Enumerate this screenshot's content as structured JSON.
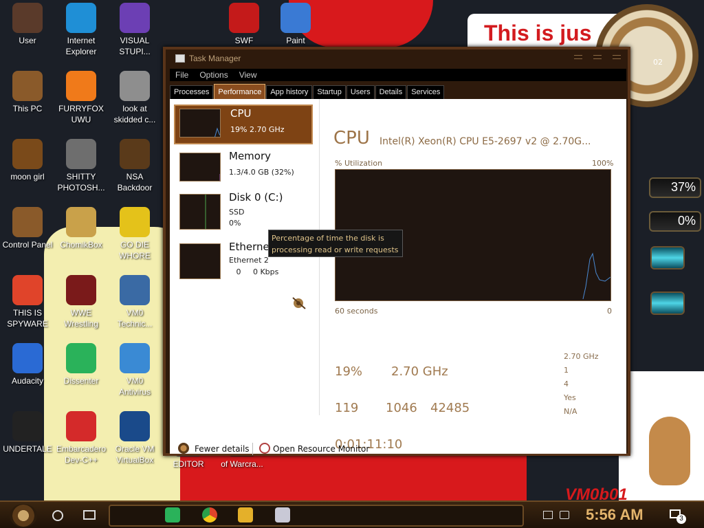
{
  "wallpaper": {
    "sign_text": "This is jus",
    "watermark": "VM0b01",
    "clock_text": "02",
    "gauges": [
      "37%",
      "0%"
    ]
  },
  "desktop_icons": [
    {
      "label": "User",
      "icon": "user-icon",
      "color": "#5a3a2a"
    },
    {
      "label": "Internet\nExplorer",
      "icon": "edge-icon",
      "color": "#1f8fd6"
    },
    {
      "label": "VISUAL\nSTUPI...",
      "icon": "visual-studio-icon",
      "color": "#6c3fb4"
    },
    {
      "label": "This PC",
      "icon": "this-pc-icon",
      "color": "#8a5a2a"
    },
    {
      "label": "FURRYFOX\nUWU",
      "icon": "firefox-icon",
      "color": "#f07a1a"
    },
    {
      "label": "look at\nskidded c...",
      "icon": "files-icon",
      "color": "#8e8e8e"
    },
    {
      "label": "moon girl",
      "icon": "moon-girl-icon",
      "color": "#7a4a1a"
    },
    {
      "label": "SHITTY\nPHOTOSH...",
      "icon": "gimp-icon",
      "color": "#6e6e6e"
    },
    {
      "label": "NSA\nBackdoor",
      "icon": "backdoor-icon",
      "color": "#5a3a1a"
    },
    {
      "label": "Control Panel",
      "icon": "control-panel-icon",
      "color": "#8a5a2a"
    },
    {
      "label": "ChomikBox",
      "icon": "chomikbox-icon",
      "color": "#c9a14a"
    },
    {
      "label": "GO DIE\nWHORE",
      "icon": "delphi-icon",
      "color": "#e4c21a"
    },
    {
      "label": "THIS IS\nSPYWARE",
      "icon": "chrome-icon",
      "color": "#e0442a"
    },
    {
      "label": "WWE\nWrestling",
      "icon": "wwe-icon",
      "color": "#7a1a1a"
    },
    {
      "label": "VM0\nTechnic...",
      "icon": "technician-icon",
      "color": "#3a6aa4"
    },
    {
      "label": "Audacity",
      "icon": "audacity-icon",
      "color": "#2a6ad4"
    },
    {
      "label": "Dissenter",
      "icon": "dissenter-icon",
      "color": "#2ab25a"
    },
    {
      "label": "VM0\nAntivirus",
      "icon": "antivirus-icon",
      "color": "#3a8ad4"
    },
    {
      "label": "UNDERTALE",
      "icon": "unity-icon",
      "color": "#222222"
    },
    {
      "label": "Embarcadero\nDev-C++",
      "icon": "devcpp-icon",
      "color": "#d42a2a"
    },
    {
      "label": "Oracle VM\nVirtualBox",
      "icon": "virtualbox-icon",
      "color": "#1a4a8a"
    },
    {
      "label": "EDITOR",
      "icon": "editor-icon",
      "color": "#4a4a4a"
    },
    {
      "label": "of Warcra...",
      "icon": "warcraft-icon",
      "color": "#4a2a1a"
    },
    {
      "label": "SWF",
      "icon": "flash-icon",
      "color": "#c41a1a"
    },
    {
      "label": "Paint",
      "icon": "paint-icon",
      "color": "#3a7ad4"
    }
  ],
  "task_manager": {
    "title": "Task Manager",
    "menu": [
      "File",
      "Options",
      "View"
    ],
    "tabs": [
      "Processes",
      "Performance",
      "App history",
      "Startup",
      "Users",
      "Details",
      "Services"
    ],
    "active_tab": "Performance",
    "sidebar": [
      {
        "name": "CPU",
        "line1": "19% 2.70 GHz",
        "line2": ""
      },
      {
        "name": "Memory",
        "line1": "1.3/4.0 GB (32%)",
        "line2": ""
      },
      {
        "name": "Disk 0 (C:)",
        "line1": "SSD",
        "line2": "0%"
      },
      {
        "name": "Ethernet",
        "line1": "Ethernet 2",
        "line2": "   0     0 Kbps"
      }
    ],
    "tooltip": "Percentage of time the disk is\nprocessing read or write requests",
    "main": {
      "title": "CPU",
      "subtitle": "Intel(R) Xeon(R) CPU E5-2697 v2 @ 2.70G...",
      "util_label": "% Utilization",
      "util_max": "100%",
      "axis_left": "60 seconds",
      "axis_right": "0",
      "utilization": "19%",
      "speed": "2.70 GHz",
      "processes": "119",
      "threads": "1046",
      "handles": "42485",
      "uptime": "0:01:11:10",
      "specs": [
        "2.70 GHz",
        "1",
        "4",
        "Yes",
        "N/A"
      ]
    },
    "footer": {
      "fewer_details": "Fewer details",
      "resource_monitor": "Open Resource Monitor"
    }
  },
  "taskbar": {
    "clock": "5:56 AM",
    "notifications": "3",
    "pinned": [
      "dissenter-icon",
      "chrome-icon",
      "file-explorer-icon",
      "task-manager-icon"
    ]
  }
}
